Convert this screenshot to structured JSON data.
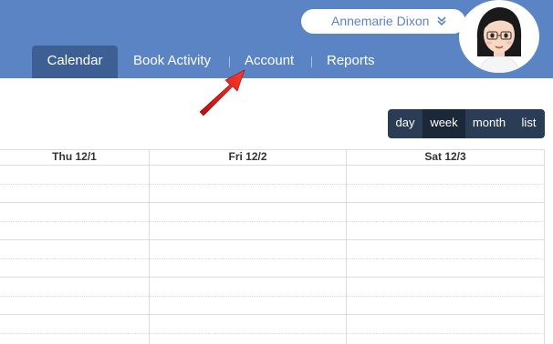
{
  "user": {
    "name": "Annemarie Dixon",
    "menu_icon": "double-chevron-down-icon"
  },
  "nav": {
    "tabs": [
      {
        "label": "Calendar",
        "active": true
      },
      {
        "label": "Book Activity",
        "active": false
      },
      {
        "label": "Account",
        "active": false
      },
      {
        "label": "Reports",
        "active": false
      }
    ]
  },
  "view_switch": {
    "buttons": [
      {
        "label": "day",
        "active": false
      },
      {
        "label": "week",
        "active": true
      },
      {
        "label": "month",
        "active": false
      },
      {
        "label": "list",
        "active": false
      }
    ]
  },
  "calendar": {
    "columns": [
      "Thu 12/1",
      "Fri 12/2",
      "Sat 12/3"
    ]
  },
  "colors": {
    "header": "#5b84c4",
    "active_tab": "#3e5f94",
    "view_switch": "#2b3d54",
    "arrow": "#e02020"
  }
}
